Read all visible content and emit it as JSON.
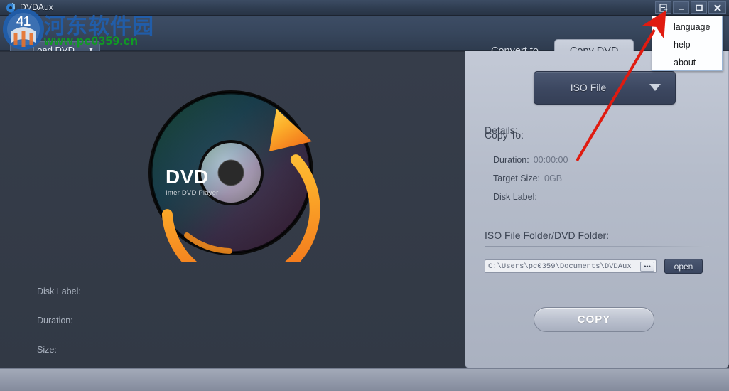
{
  "window": {
    "title": "DVDAux",
    "icon": "app-disc-icon",
    "buttons": [
      {
        "name": "menu-button",
        "glyph": "menu-icon"
      },
      {
        "name": "minimize-button",
        "glyph": "minimize-icon"
      },
      {
        "name": "maximize-button",
        "glyph": "maximize-icon"
      },
      {
        "name": "close-button",
        "glyph": "close-icon"
      }
    ]
  },
  "menu": {
    "open": true,
    "items": [
      {
        "label": "language"
      },
      {
        "label": "help"
      },
      {
        "label": "about"
      }
    ]
  },
  "toolbar": {
    "load_dvd_label": "Load DVD",
    "load_dvd_caret": "▼"
  },
  "tabs": [
    {
      "label": "Convert to",
      "active": false
    },
    {
      "label": "Copy DVD",
      "active": true
    }
  ],
  "stage": {
    "disc": {
      "title": "DVD",
      "subtitle": "Inter DVD Player"
    },
    "info": [
      {
        "label": "Disk Label:"
      },
      {
        "label": "Duration:"
      },
      {
        "label": "Size:"
      }
    ]
  },
  "panel": {
    "copy_to_label": "Copy To:",
    "copy_to_value": "ISO File",
    "details_label": "Details:",
    "details": [
      {
        "label": "Duration:",
        "value": "00:00:00"
      },
      {
        "label": "Target Size:",
        "value": "0GB"
      },
      {
        "label": "Disk Label:",
        "value": ""
      }
    ],
    "folder_label": "ISO File Folder/DVD Folder:",
    "path_value": "C:\\Users\\pc0359\\Documents\\DVDAux",
    "path_placeholder": "C:\\Users\\pc0359\\Documents\\DVDAux",
    "browse_label": "•••",
    "open_label": "open",
    "copy_label": "COPY"
  },
  "watermark": {
    "cn_text": "河东软件园",
    "url_text": "www.pc0359.cn"
  },
  "colors": {
    "titlebar": "#2f3d51",
    "toolbar": "#37465c",
    "stage": "#343b48",
    "panel": "#b5bcca",
    "footer": "#8d94a5",
    "accent_orange": "#f59a1e",
    "annotation_red": "#e01b10",
    "watermark_blue": "#1f5fb0",
    "watermark_green": "#0f9b23"
  }
}
